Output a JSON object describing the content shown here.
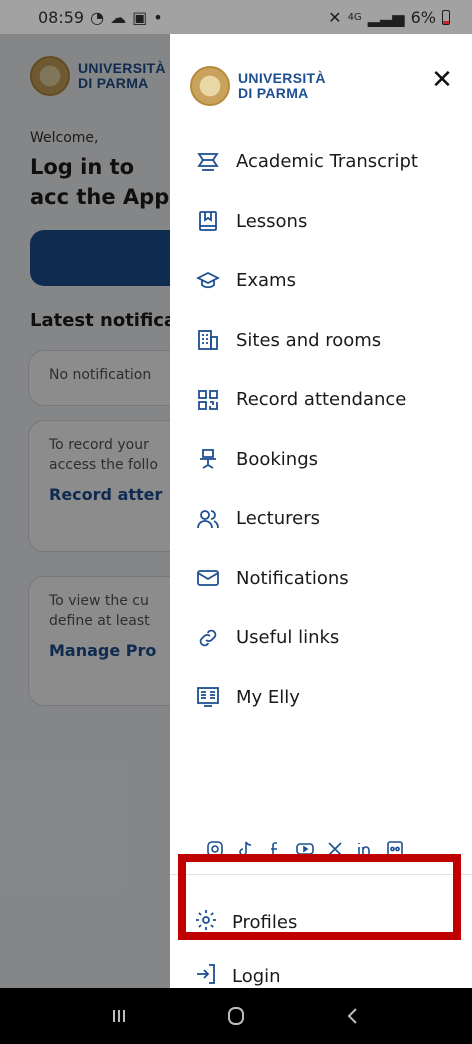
{
  "status": {
    "time": "08:59",
    "network": "4G",
    "battery": "6%"
  },
  "background": {
    "brand_line1": "UNIVERSITÀ",
    "brand_line2": "DI PARMA",
    "welcome": "Welcome,",
    "login_heading": "Log in to acc the App",
    "section_title": "Latest notifica",
    "card1_text": "No notification",
    "card2_text": "To record your access the follo",
    "card2_link": "Record atter",
    "card3_text": "To view the cu define at least",
    "card3_link": "Manage Pro"
  },
  "drawer": {
    "brand_line1": "UNIVERSITÀ",
    "brand_line2": "DI PARMA",
    "close": "✕",
    "items": [
      {
        "label": "Academic Transcript",
        "icon": "academic-transcript-icon"
      },
      {
        "label": "Lessons",
        "icon": "lessons-icon"
      },
      {
        "label": "Exams",
        "icon": "exams-icon"
      },
      {
        "label": "Sites and rooms",
        "icon": "sites-icon"
      },
      {
        "label": "Record attendance",
        "icon": "qr-icon"
      },
      {
        "label": "Bookings",
        "icon": "bookings-icon"
      },
      {
        "label": "Lecturers",
        "icon": "lecturers-icon"
      },
      {
        "label": "Notifications",
        "icon": "mail-icon"
      },
      {
        "label": "Useful links",
        "icon": "link-icon"
      },
      {
        "label": "My Elly",
        "icon": "elly-icon"
      }
    ],
    "profiles": "Profiles",
    "login": "Login"
  },
  "colors": {
    "brand": "#1d4f91",
    "highlight": "#c00000"
  }
}
